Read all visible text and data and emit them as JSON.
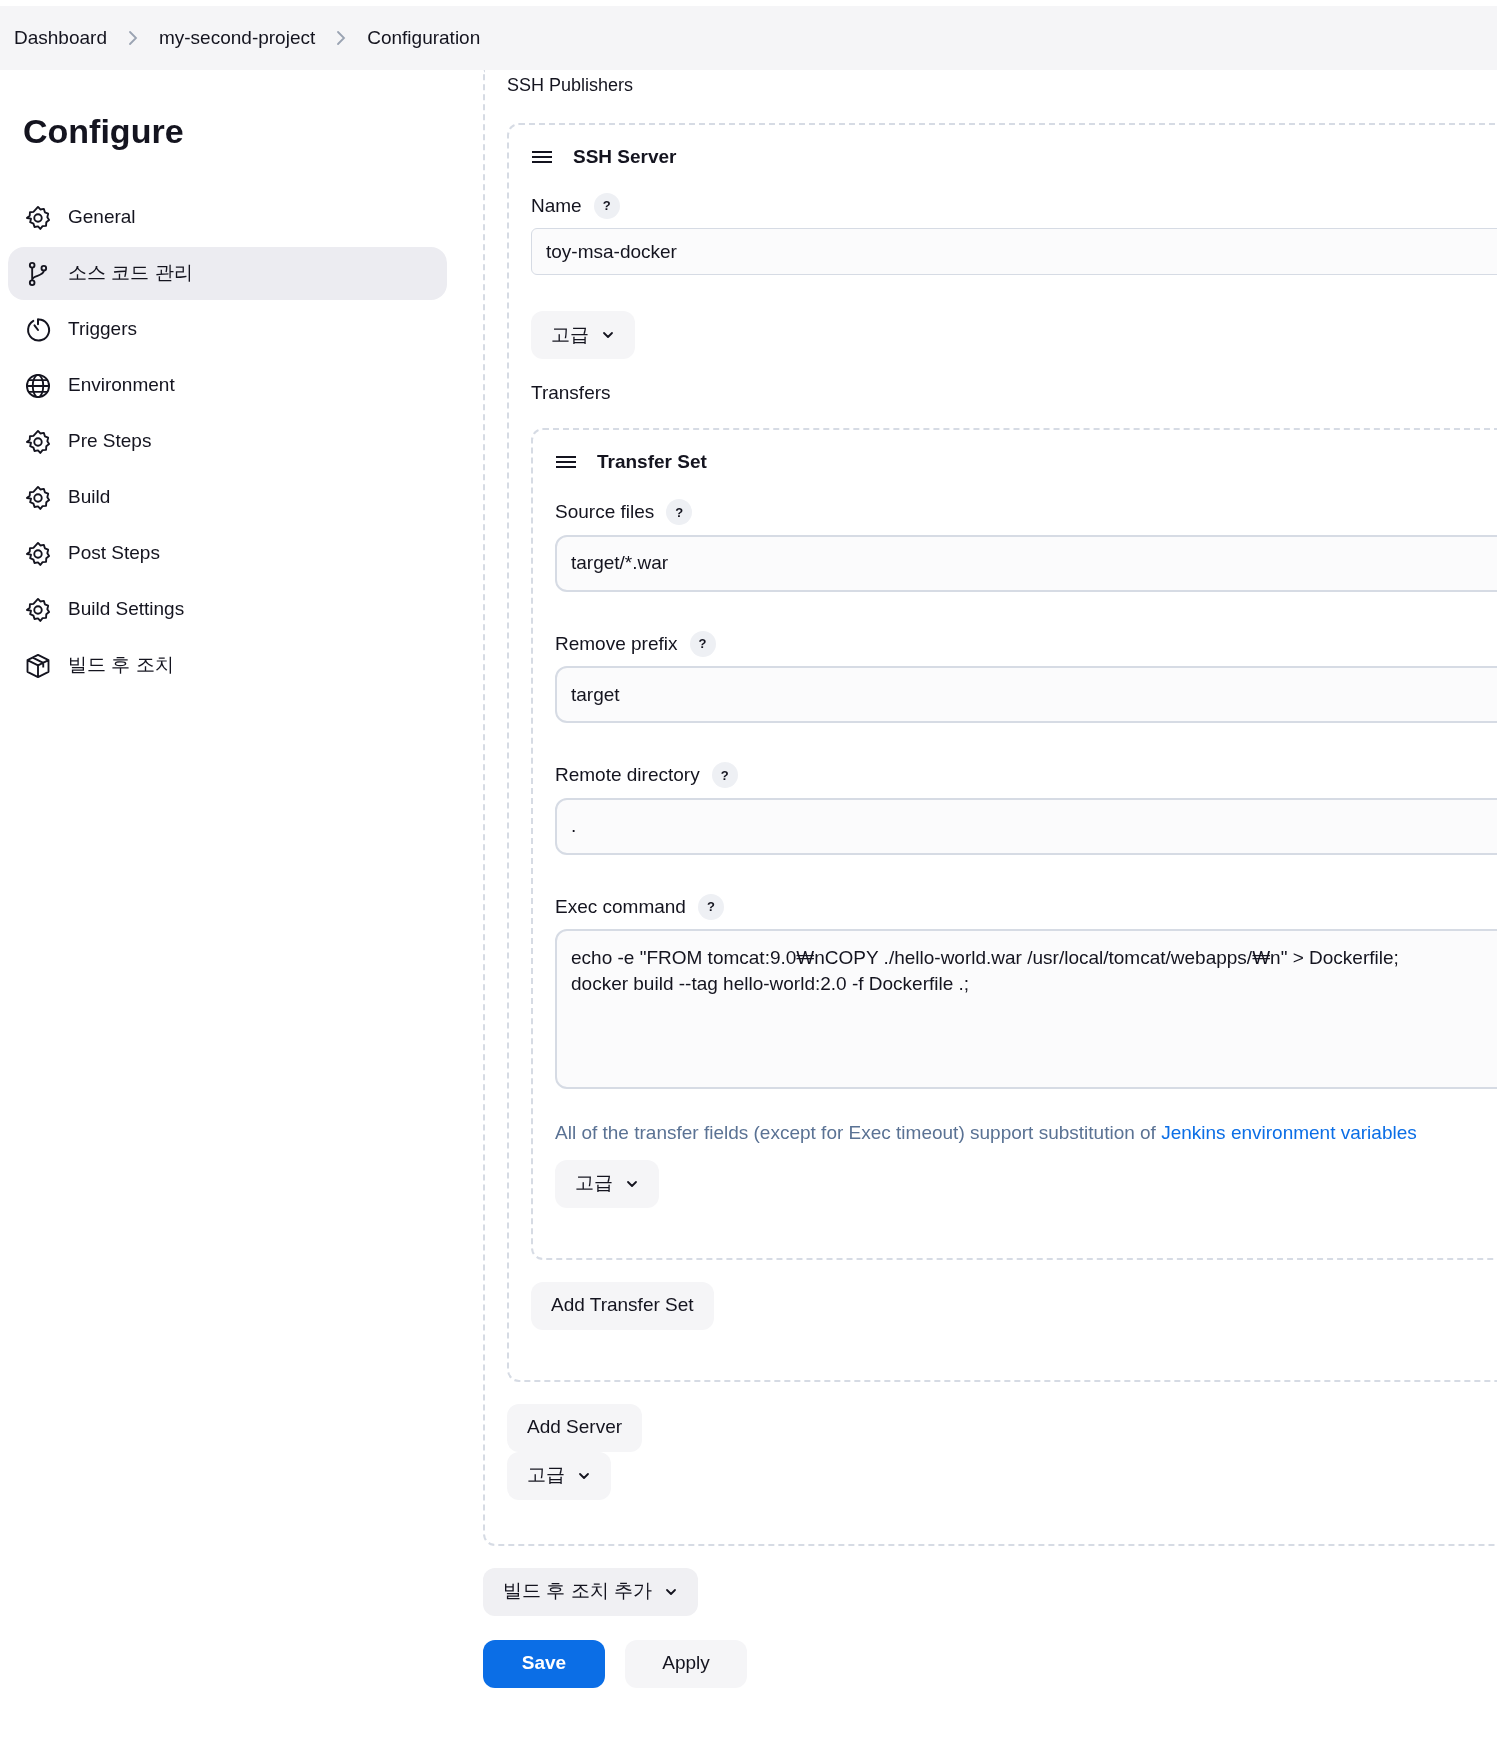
{
  "breadcrumbs": [
    "Dashboard",
    "my-second-project",
    "Configuration"
  ],
  "sidebar": {
    "title": "Configure",
    "items": [
      {
        "label": "General",
        "kind": "gear",
        "selected": false
      },
      {
        "label": "소스 코드 관리",
        "kind": "branch",
        "selected": true
      },
      {
        "label": "Triggers",
        "kind": "clock",
        "selected": false
      },
      {
        "label": "Environment",
        "kind": "globe",
        "selected": false
      },
      {
        "label": "Pre Steps",
        "kind": "gear",
        "selected": false
      },
      {
        "label": "Build",
        "kind": "gear",
        "selected": false
      },
      {
        "label": "Post Steps",
        "kind": "gear",
        "selected": false
      },
      {
        "label": "Build Settings",
        "kind": "gear",
        "selected": false
      },
      {
        "label": "빌드 후 조치",
        "kind": "box",
        "selected": false
      }
    ]
  },
  "section_label": "SSH Publishers",
  "server": {
    "title": "SSH Server",
    "name_label": "Name",
    "name_help": "?",
    "name_value": "toy-msa-docker",
    "advanced": "고급",
    "transfers_label": "Transfers",
    "transfer_set": {
      "title": "Transfer Set",
      "fields": [
        {
          "kind": "input",
          "label": "Source files",
          "help": "?",
          "value": "target/*.war"
        },
        {
          "kind": "input",
          "label": "Remove prefix",
          "help": "?",
          "value": "target"
        },
        {
          "kind": "input",
          "label": "Remote directory",
          "help": "?",
          "value": "."
        },
        {
          "kind": "textarea",
          "label": "Exec command",
          "help": "?",
          "value": "echo -e \"FROM tomcat:9.0₩nCOPY ./hello-world.war /usr/local/tomcat/webapps/₩n\" > Dockerfile;\ndocker build --tag hello-world:2.0 -f Dockerfile .;"
        }
      ],
      "note": "All of the transfer fields (except for Exec timeout) support substitution of",
      "note_link": "Jenkins environment variables",
      "advanced": "고급"
    },
    "add_transfer": "Add Transfer Set"
  },
  "add_server": "Add Server",
  "advanced": "고급",
  "add_post_build": "빌드 후 조치 추가",
  "buttons": [
    {
      "label": "Save",
      "kind": "primary"
    },
    {
      "label": "Apply",
      "kind": "secondary"
    }
  ]
}
